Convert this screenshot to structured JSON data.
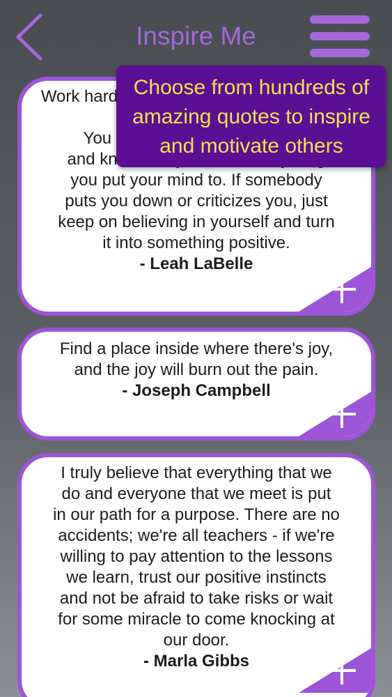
{
  "header": {
    "title": "Inspire Me",
    "back_icon": "chevron-left-icon",
    "menu_icon": "hamburger-menu-icon"
  },
  "tooltip": {
    "text": "Choose from hundreds of\namazing quotes to inspire\nand motivate others"
  },
  "quotes": [
    {
      "text": "Work hard and don't give up hope, it won't come easy.\nYou have to believe in yourself\nand know that you can do anything\nyou put your mind to. If somebody\nputs you down or criticizes you, just\nkeep on believing in yourself and turn\nit into something positive.",
      "author": "- Leah LaBelle"
    },
    {
      "text": "Find a place inside where there's joy,\nand the joy will burn out the pain.",
      "author": "- Joseph Campbell"
    },
    {
      "text": "I truly believe that everything that we\ndo and everyone that we meet is put\nin our path for a purpose. There are no\naccidents; we're all teachers - if we're\nwilling to pay attention to the lessons\nwe learn, trust our positive instincts\nand not be afraid to take risks or wait\nfor some miracle to come knocking at\nour door.",
      "author": "- Marla Gibbs"
    }
  ],
  "add_icon": "plus-icon",
  "colors": {
    "accent": "#9b55d6",
    "title": "#a569dc",
    "tooltip_bg": "#5b0f94",
    "tooltip_text": "#f1e34f",
    "card_bg": "#ffffff"
  }
}
